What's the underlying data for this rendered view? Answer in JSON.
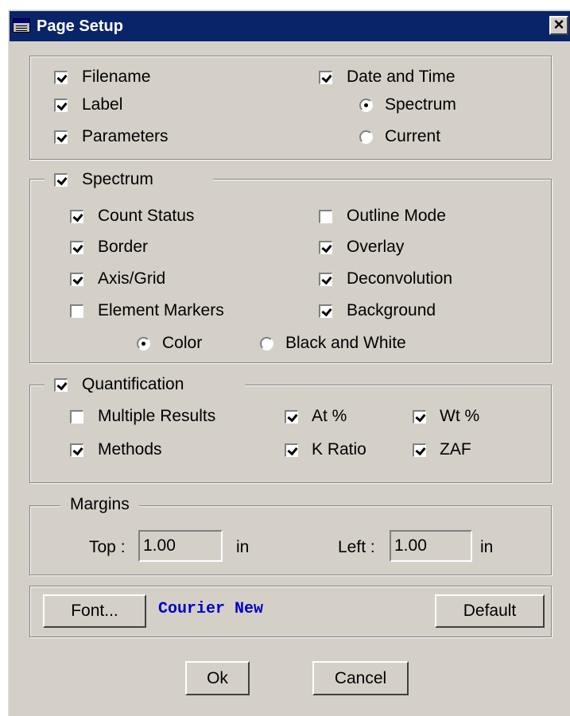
{
  "window": {
    "title": "Page Setup",
    "close_glyph": "×"
  },
  "header_section": {
    "filename": {
      "label": "Filename",
      "checked": true
    },
    "label": {
      "label": "Label",
      "checked": true
    },
    "parameters": {
      "label": "Parameters",
      "checked": true
    },
    "date_time": {
      "label": "Date and Time",
      "checked": true
    },
    "spectrum_radio": {
      "label": "Spectrum",
      "selected": true
    },
    "current_radio": {
      "label": "Current",
      "selected": false
    }
  },
  "spectrum": {
    "legend": "Spectrum",
    "checked": true,
    "count_status": {
      "label": "Count Status",
      "checked": true
    },
    "border": {
      "label": "Border",
      "checked": true
    },
    "axis_grid": {
      "label": "Axis/Grid",
      "checked": true
    },
    "element_markers": {
      "label": "Element Markers",
      "checked": false
    },
    "outline_mode": {
      "label": "Outline Mode",
      "checked": false
    },
    "overlay": {
      "label": "Overlay",
      "checked": true
    },
    "deconvolution": {
      "label": "Deconvolution",
      "checked": true
    },
    "background": {
      "label": "Background",
      "checked": true
    },
    "color_radio": {
      "label": "Color",
      "selected": true
    },
    "bw_radio": {
      "label": "Black and White",
      "selected": false
    }
  },
  "quantification": {
    "legend": "Quantification",
    "checked": true,
    "multiple_results": {
      "label": "Multiple Results",
      "checked": false
    },
    "methods": {
      "label": "Methods",
      "checked": true
    },
    "at_pct": {
      "label": "At %",
      "checked": true
    },
    "k_ratio": {
      "label": "K Ratio",
      "checked": true
    },
    "wt_pct": {
      "label": "Wt %",
      "checked": true
    },
    "zaf": {
      "label": "ZAF",
      "checked": true
    }
  },
  "margins": {
    "legend": "Margins",
    "top_label": "Top :",
    "top_value": "1.00",
    "top_unit": "in",
    "left_label": "Left :",
    "left_value": "1.00",
    "left_unit": "in"
  },
  "font": {
    "button_label": "Font...",
    "current_font": "Courier New",
    "default_label": "Default",
    "font_color": "#0000c8"
  },
  "actions": {
    "ok_label": "Ok",
    "cancel_label": "Cancel"
  },
  "colors": {
    "title_bar": "#0a246a",
    "dialog_bg": "#d4d0c8"
  }
}
